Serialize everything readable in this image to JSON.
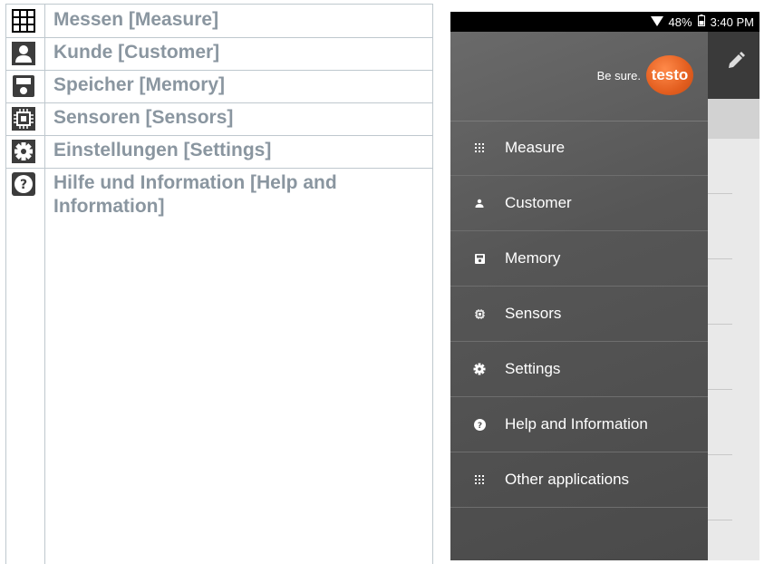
{
  "legend": {
    "rows": [
      {
        "icon": "grid-icon",
        "label": "Messen [Measure]"
      },
      {
        "icon": "person-icon",
        "label": "Kunde [Customer]"
      },
      {
        "icon": "save-icon",
        "label": "Speicher [Memory]"
      },
      {
        "icon": "chip-icon",
        "label": "Sensoren [Sensors]"
      },
      {
        "icon": "gear-icon",
        "label": "Einstellungen [Settings]"
      },
      {
        "icon": "help-icon",
        "label": "Hilfe und Information [Help and Information]"
      }
    ]
  },
  "phone": {
    "status": {
      "battery": "48%",
      "time": "3:40 PM"
    },
    "brand": {
      "tagline": "Be sure.",
      "logo": "testo"
    },
    "menu": [
      {
        "icon": "grid-icon",
        "label": "Measure"
      },
      {
        "icon": "person-icon",
        "label": "Customer"
      },
      {
        "icon": "save-icon",
        "label": "Memory"
      },
      {
        "icon": "chip-icon",
        "label": "Sensors"
      },
      {
        "icon": "gear-icon",
        "label": "Settings"
      },
      {
        "icon": "help-icon",
        "label": "Help and Information"
      },
      {
        "icon": "grid-icon",
        "label": "Other applications"
      }
    ]
  }
}
